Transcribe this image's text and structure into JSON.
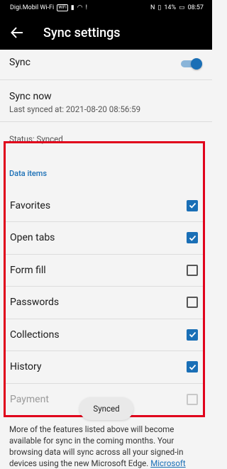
{
  "status_bar": {
    "carrier": "Digi.Mobil Wi-Fi",
    "wifi_badge": "WiFi",
    "battery": "14%",
    "time": "08:57"
  },
  "appbar": {
    "title": "Sync settings"
  },
  "sync": {
    "label": "Sync",
    "enabled": true
  },
  "sync_now": {
    "label": "Sync now",
    "last_synced": "Last synced at: 2021-08-20 08:56:59"
  },
  "status": {
    "text": "Status: Synced"
  },
  "data_items": {
    "heading": "Data items",
    "items": [
      {
        "label": "Favorites",
        "checked": true
      },
      {
        "label": "Open tabs",
        "checked": true
      },
      {
        "label": "Form fill",
        "checked": false
      },
      {
        "label": "Passwords",
        "checked": false
      },
      {
        "label": "Collections",
        "checked": true
      },
      {
        "label": "History",
        "checked": true
      },
      {
        "label": "Payment",
        "checked": false,
        "disabled": true
      }
    ]
  },
  "toast": {
    "text": "Synced"
  },
  "footer": {
    "text": "More of the features listed above will become available for sync in the coming months. Your browsing data will sync across all your signed-in devices using the new Microsoft Edge.",
    "link": "Microsoft"
  },
  "colors": {
    "accent": "#1a6fb6",
    "highlight": "#e0001b"
  }
}
